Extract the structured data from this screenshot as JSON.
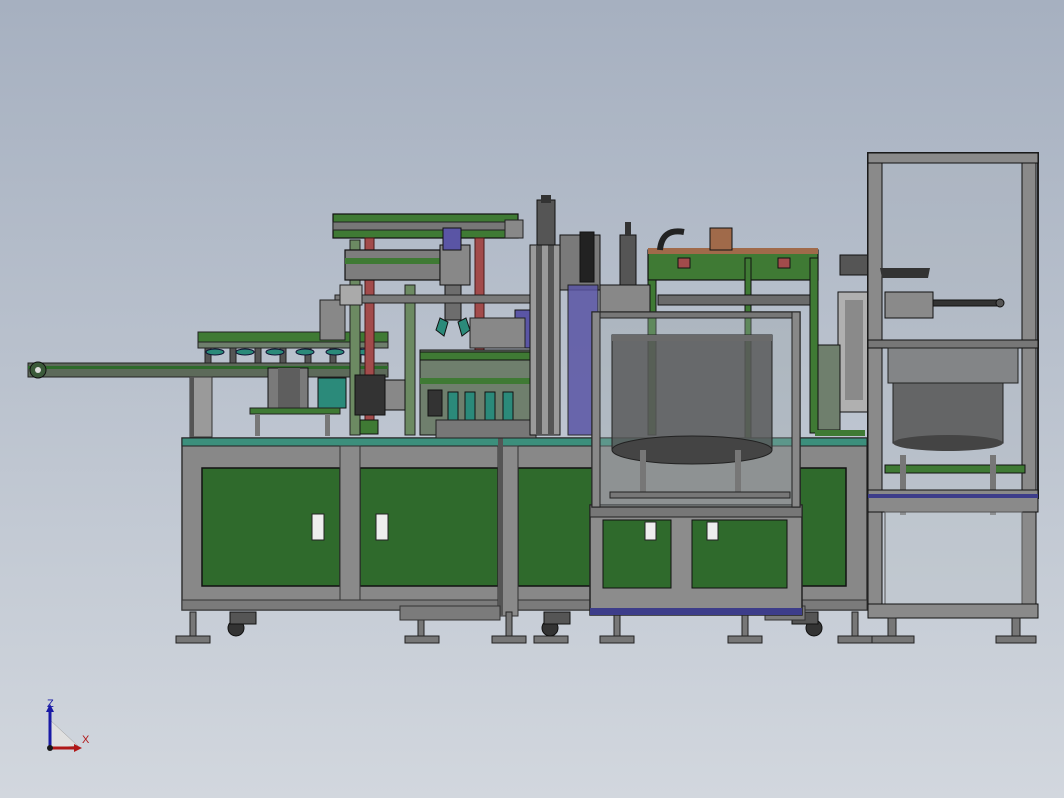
{
  "viewport": {
    "background_top": "#a6b0c0",
    "background_bottom": "#d2d7de"
  },
  "model": {
    "frame_color": "#808080",
    "panel_color": "#2f6a2c",
    "steel_green": "#3f7a34",
    "accent_red": "#a24b4b",
    "accent_teal": "#2b8a7a",
    "accent_purple": "#5a55a5"
  },
  "triad": {
    "z_label": "Z",
    "x_label": "X",
    "z_color": "#1a1aa6",
    "x_color": "#b01818"
  }
}
